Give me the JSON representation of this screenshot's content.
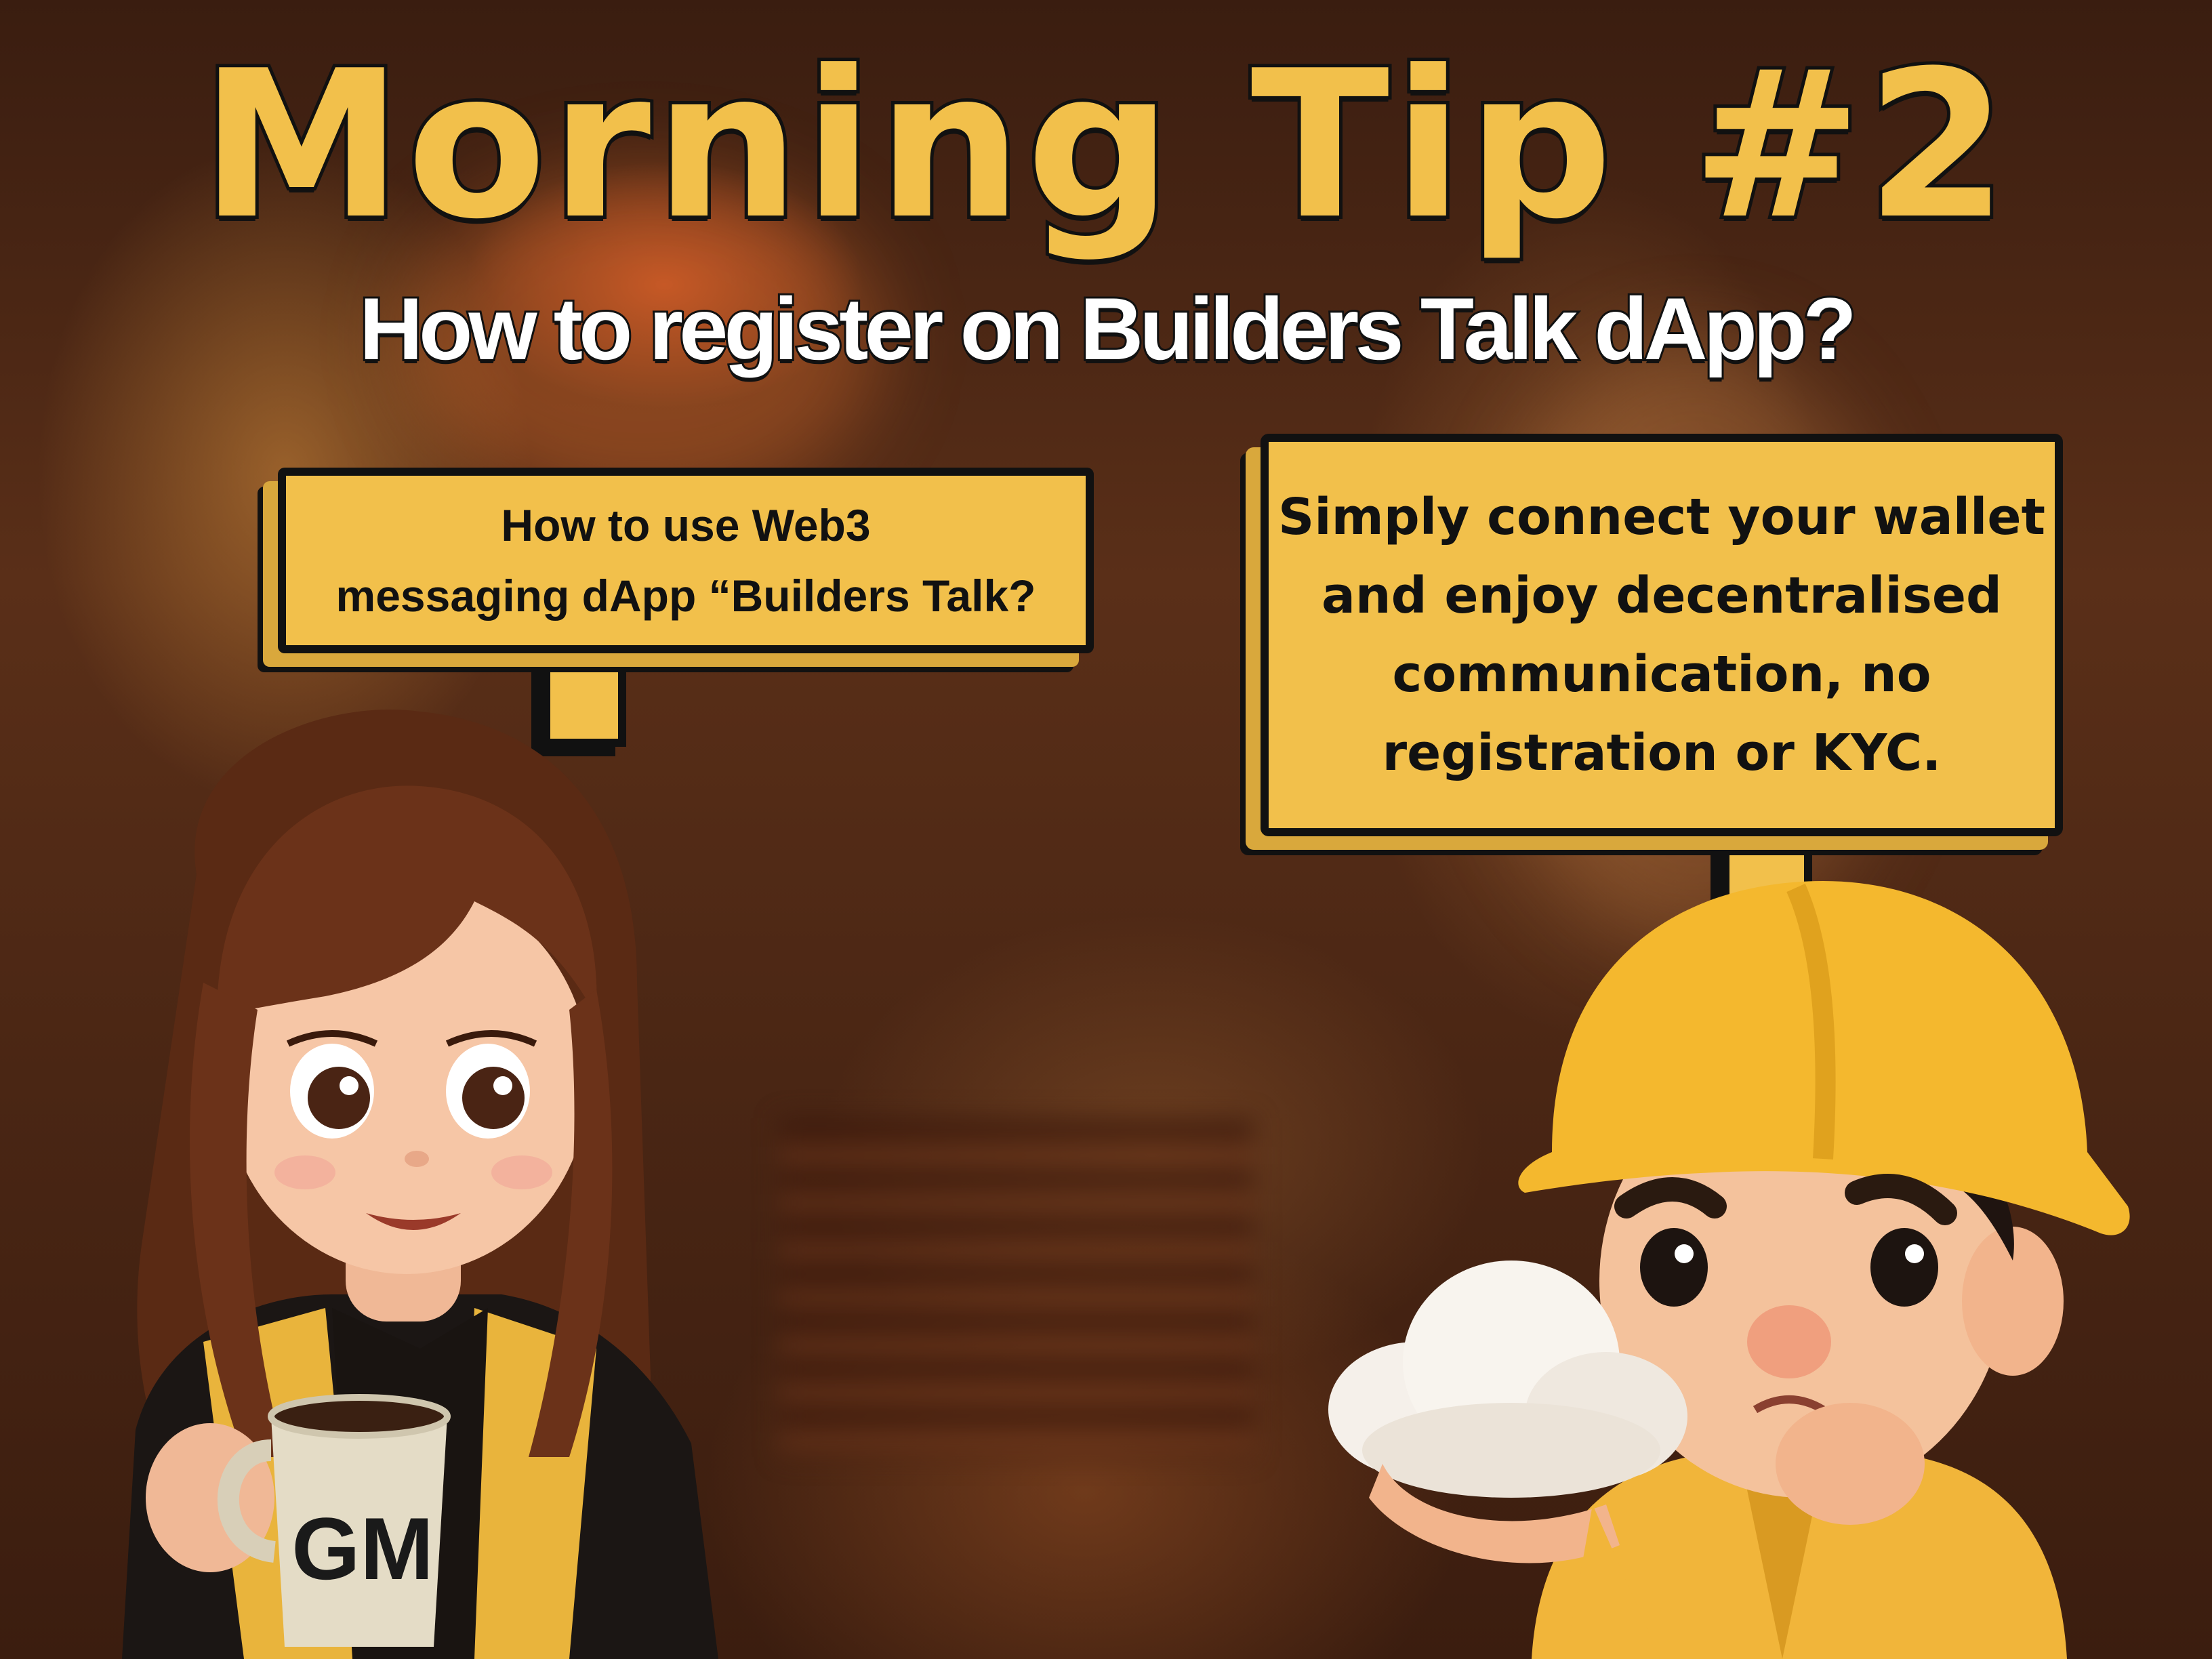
{
  "title": "Morning Tip #2",
  "subtitle": "How to register on Builders Talk dApp?",
  "question_bubble": {
    "lines": [
      "How to use Web3",
      "messaging dApp “Builders Talk?"
    ]
  },
  "answer_bubble": {
    "lines": [
      "Simply connect your wallet",
      "and enjoy decentralised",
      "communication, no",
      "registration or KYC."
    ]
  },
  "mug": {
    "label": "GM"
  },
  "colors": {
    "accent": "#f2c04b",
    "outline": "#111111",
    "subtitle": "#ffffff"
  }
}
